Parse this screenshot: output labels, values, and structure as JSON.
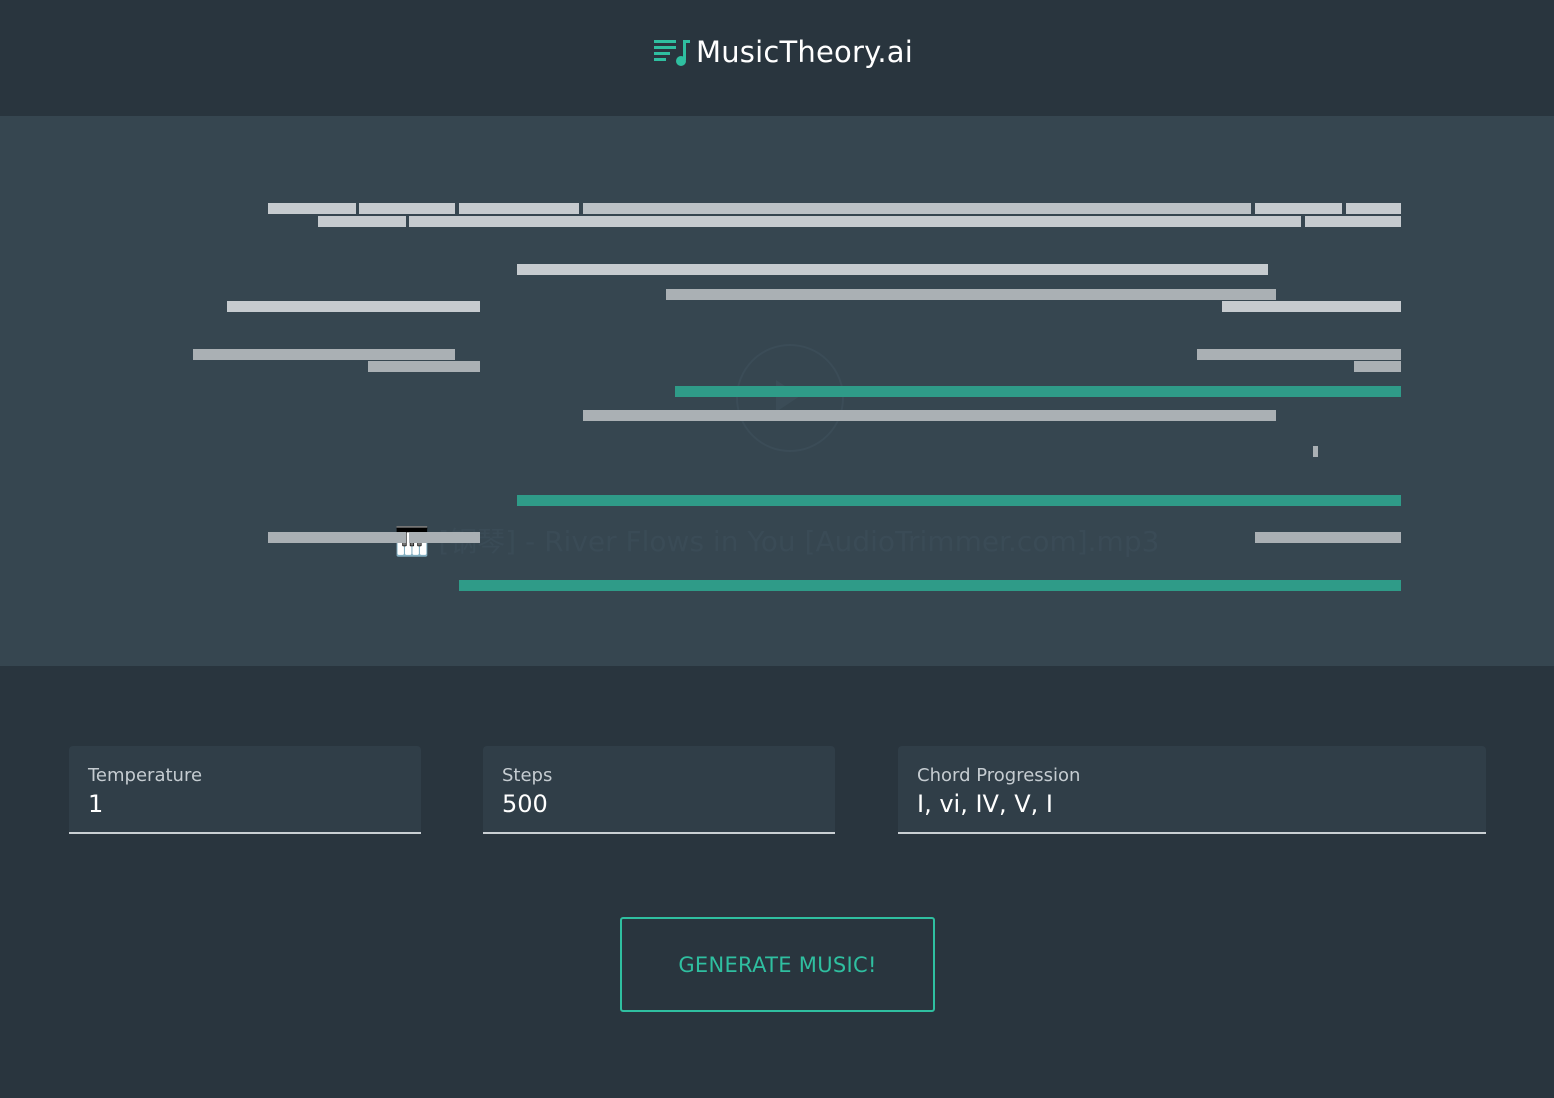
{
  "header": {
    "brand": "MusicTheory.ai",
    "icon": "playlist-music-icon",
    "accent_color": "#2fbfa0"
  },
  "visualizer": {
    "track_name": "🎹 [钢琴] - River Flows in You [AudioTrimmer.com].mp3",
    "note_colors": {
      "played": "#2f9b88",
      "upcoming": "#c6cbcf",
      "dim": "#aab0b4"
    }
  },
  "form": {
    "temperature": {
      "label": "Temperature",
      "value": "1"
    },
    "steps": {
      "label": "Steps",
      "value": "500"
    },
    "chord_progression": {
      "label": "Chord Progression",
      "value": "I, vi, IV, V, I"
    }
  },
  "generate_button": {
    "label": "GENERATE MUSIC!"
  }
}
